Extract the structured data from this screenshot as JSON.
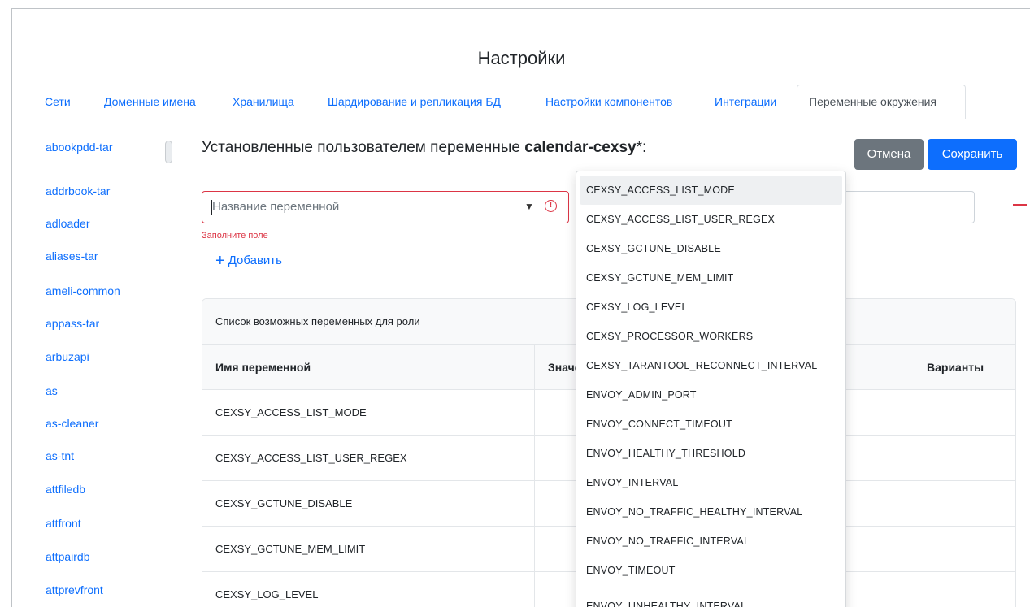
{
  "page": {
    "title": "Настройки"
  },
  "tabs": [
    {
      "label": "Сети",
      "active": false
    },
    {
      "label": "Доменные имена",
      "active": false
    },
    {
      "label": "Хранилища",
      "active": false
    },
    {
      "label": "Шардирование и репликация БД",
      "active": false
    },
    {
      "label": "Настройки компонентов",
      "active": false
    },
    {
      "label": "Интеграции",
      "active": false
    },
    {
      "label": "Переменные окружения",
      "active": true
    }
  ],
  "sidebar": {
    "items": [
      "abookpdd-tar",
      "addrbook-tar",
      "adloader",
      "aliases-tar",
      "ameli-common",
      "appass-tar",
      "arbuzapi",
      "as",
      "as-cleaner",
      "as-tnt",
      "attfiledb",
      "attfront",
      "attpairdb",
      "attprevfront"
    ]
  },
  "section": {
    "title_prefix": "Установленные пользователем переменные ",
    "role": "calendar-cexsy",
    "suffix": "*:"
  },
  "buttons": {
    "cancel": "Отмена",
    "save": "Сохранить"
  },
  "variable_input": {
    "placeholder": "Название переменной",
    "error_text": "Заполните поле",
    "error_icon": "!"
  },
  "add_label": "Добавить",
  "list_card": {
    "header": "Список возможных переменных для роли",
    "columns": [
      "Имя переменной",
      "Значение",
      "Варианты"
    ],
    "rows": [
      "CEXSY_ACCESS_LIST_MODE",
      "CEXSY_ACCESS_LIST_USER_REGEX",
      "CEXSY_GCTUNE_DISABLE",
      "CEXSY_GCTUNE_MEM_LIMIT",
      "CEXSY_LOG_LEVEL"
    ]
  },
  "dropdown": {
    "options": [
      "CEXSY_ACCESS_LIST_MODE",
      "CEXSY_ACCESS_LIST_USER_REGEX",
      "CEXSY_GCTUNE_DISABLE",
      "CEXSY_GCTUNE_MEM_LIMIT",
      "CEXSY_LOG_LEVEL",
      "CEXSY_PROCESSOR_WORKERS",
      "CEXSY_TARANTOOL_RECONNECT_INTERVAL",
      "ENVOY_ADMIN_PORT",
      "ENVOY_CONNECT_TIMEOUT",
      "ENVOY_HEALTHY_THRESHOLD",
      "ENVOY_INTERVAL",
      "ENVOY_NO_TRAFFIC_HEALTHY_INTERVAL",
      "ENVOY_NO_TRAFFIC_INTERVAL",
      "ENVOY_TIMEOUT",
      "ENVOY_UNHEALTHY_INTERVAL"
    ],
    "highlighted_index": 0
  },
  "colors": {
    "link": "#0d6efd",
    "danger": "#dc3545",
    "secondary": "#6c757d"
  }
}
